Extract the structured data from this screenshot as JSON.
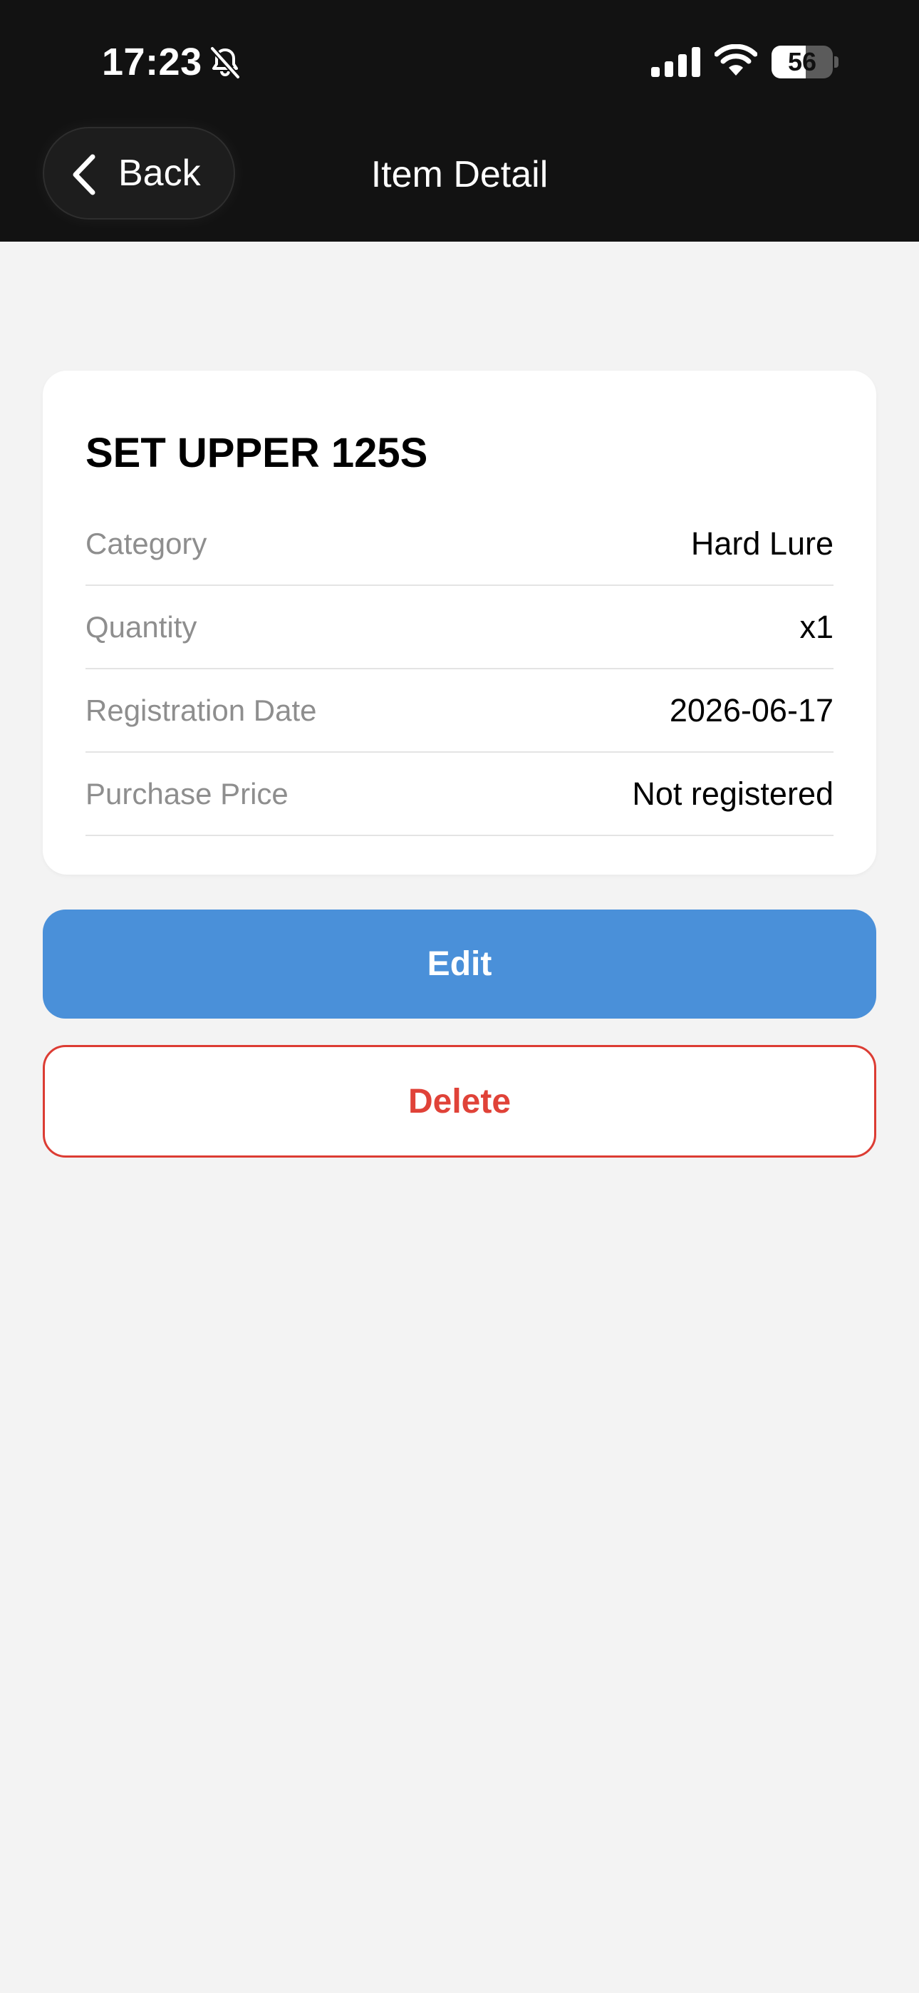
{
  "status_bar": {
    "time": "17:23",
    "battery_level": "56",
    "battery_fraction": 0.56
  },
  "header": {
    "back_label": "Back",
    "title": "Item Detail"
  },
  "item": {
    "name": "SET UPPER 125S",
    "rows": [
      {
        "label": "Category",
        "value": "Hard Lure"
      },
      {
        "label": "Quantity",
        "value": "x1"
      },
      {
        "label": "Registration Date",
        "value": "2026-06-17"
      },
      {
        "label": "Purchase Price",
        "value": "Not registered"
      }
    ]
  },
  "actions": {
    "edit_label": "Edit",
    "delete_label": "Delete"
  },
  "colors": {
    "header_background": "#121212",
    "page_background": "#f3f3f3",
    "edit_button": "#4a90d9",
    "delete_accent": "#e04238"
  },
  "icons": {
    "mute": "bell-off-icon",
    "signal": "signal-icon",
    "wifi": "wifi-icon",
    "back": "chevron-left-icon"
  }
}
